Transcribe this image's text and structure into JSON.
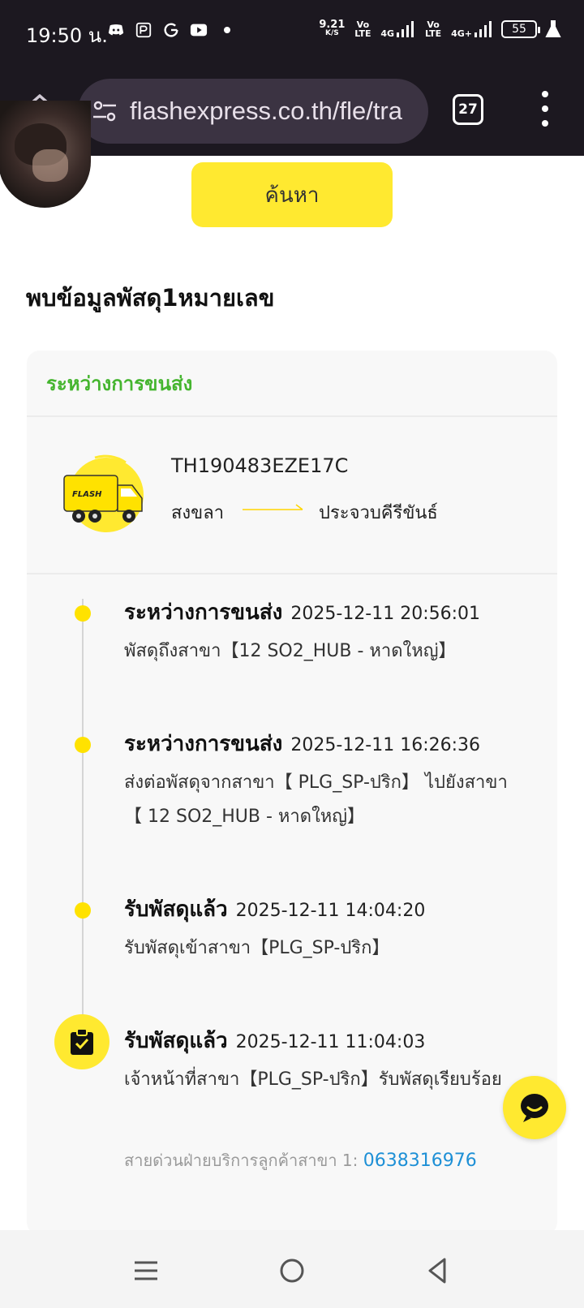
{
  "status_bar": {
    "time": "19:50 น.",
    "net_speed": "9.21",
    "net_unit": "K/S",
    "vo_lte_1": "Vo LTE",
    "net_4g_1": "4G",
    "vo_lte_2": "Vo LTE",
    "net_4g_2": "4G+",
    "battery": "55"
  },
  "browser": {
    "url": "flashexpress.co.th/fle/tra",
    "tab_count": "27"
  },
  "page": {
    "search_label": "ค้นหา",
    "found_text": "พบข้อมูลพัสดุ1หมายเลข"
  },
  "parcel": {
    "status": "ระหว่างการขนส่ง",
    "tracking_number": "TH190483EZE17C",
    "origin": "สงขลา",
    "destination": "ประจวบคีรีขันธ์",
    "accent_color": "#ffe930",
    "status_color": "#45b52f"
  },
  "timeline": [
    {
      "title": "ระหว่างการขนส่ง",
      "time": "2025-12-11 20:56:01",
      "desc": "พัสดุถึงสาขา【12 SO2_HUB - หาดใหญ่】"
    },
    {
      "title": "ระหว่างการขนส่ง",
      "time": "2025-12-11 16:26:36",
      "desc": "ส่งต่อพัสดุจากสาขา【 PLG_SP-ปริก】 ไปยังสาขา【 12 SO2_HUB - หาดใหญ่】"
    },
    {
      "title": "รับพัสดุแล้ว",
      "time": "2025-12-11 14:04:20",
      "desc": "รับพัสดุเข้าสาขา【PLG_SP-ปริก】"
    },
    {
      "title": "รับพัสดุแล้ว",
      "time": "2025-12-11 11:04:03",
      "desc": "เจ้าหน้าที่สาขา【PLG_SP-ปริก】รับพัสดุเรียบร้อย",
      "hotline_label": "สายด่วนฝ่ายบริการลูกค้าสาขา 1:",
      "hotline_phone": "0638316976"
    }
  ],
  "icons": {
    "home": "home-icon",
    "site_settings": "tune-icon",
    "menu": "more-vert-icon",
    "chat": "chat-icon",
    "truck": "truck-icon",
    "clipboard": "clipboard-check-icon",
    "nav_recents": "recents-icon",
    "nav_home": "circle-home-icon",
    "nav_back": "back-icon"
  }
}
